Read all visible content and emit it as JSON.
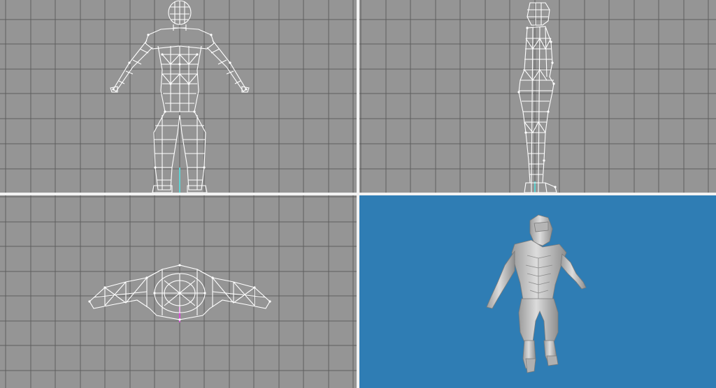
{
  "app": {
    "viewports": [
      {
        "id": "front",
        "view": "front",
        "mode": "wireframe"
      },
      {
        "id": "side",
        "view": "side",
        "mode": "wireframe"
      },
      {
        "id": "top",
        "view": "top",
        "mode": "wireframe"
      },
      {
        "id": "perspective",
        "view": "perspective",
        "mode": "shaded"
      }
    ],
    "colors": {
      "ortho_background": "#959595",
      "grid_line": "#5e5e5e",
      "wire": "#ffffff",
      "perspective_background": "#2f7db4",
      "mesh_shaded": "#c9c9c9",
      "divider": "#f2f2f2",
      "axis_y": "#5fd1d1",
      "axis_z": "#d64fd6"
    },
    "subject_icon": "humanoid-mesh-icon"
  }
}
